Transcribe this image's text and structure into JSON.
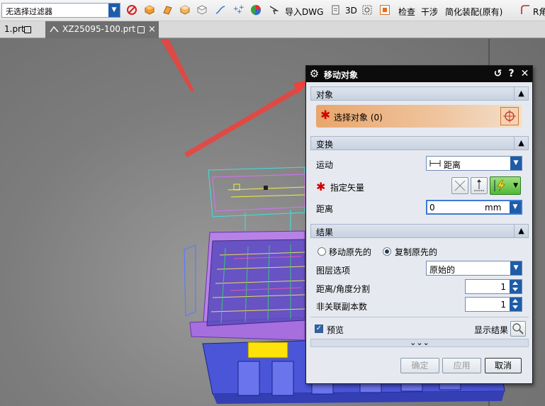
{
  "toolbar": {
    "filter_value": "无选择过滤器",
    "import_dwg": "导入DWG",
    "view_3d": "3D",
    "check": "检查",
    "interference": "干涉",
    "simplify_assembly": "简化装配(原有)",
    "r_partial": "R角"
  },
  "tabs": [
    {
      "label": "1.prt"
    },
    {
      "label": "XZ25095-100.prt",
      "close": "×"
    }
  ],
  "dialog": {
    "title": "移动对象",
    "section_object": "对象",
    "select_object": "选择对象 (0)",
    "section_transform": "变换",
    "motion_label": "运动",
    "motion_value": "距离",
    "vector_label": "指定矢量",
    "distance_label": "距离",
    "distance_value": "0",
    "distance_unit": "mm",
    "section_result": "结果",
    "move_original": "移动原先的",
    "copy_original": "复制原先的",
    "layer_option_label": "图层选项",
    "layer_option_value": "原始的",
    "distance_angle_split_label": "距离/角度分割",
    "distance_angle_split_value": "1",
    "non_assoc_copies_label": "非关联副本数",
    "non_assoc_copies_value": "1",
    "preview_label": "预览",
    "show_result_label": "显示结果",
    "more_chevrons": "⌄⌄⌄",
    "ok_label": "确定",
    "apply_label": "应用",
    "cancel_label": "取消"
  },
  "colors": {
    "accent_blue": "#1e5ca8",
    "annotation_arrow": "#f0413a",
    "required_star": "#d40000"
  }
}
